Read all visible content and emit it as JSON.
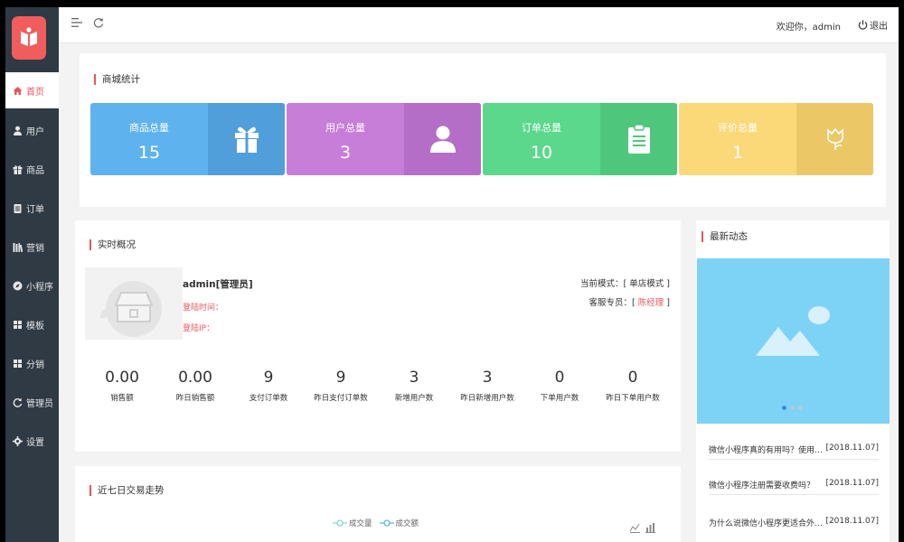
{
  "sidebar": {
    "items": [
      {
        "label": "首页",
        "icon": "home-icon",
        "active": true
      },
      {
        "label": "用户",
        "icon": "user-icon"
      },
      {
        "label": "商品",
        "icon": "gift-icon"
      },
      {
        "label": "订单",
        "icon": "clipboard-icon"
      },
      {
        "label": "营销",
        "icon": "books-icon"
      },
      {
        "label": "小程序",
        "icon": "compass-icon"
      },
      {
        "label": "模板",
        "icon": "grid-icon"
      },
      {
        "label": "分销",
        "icon": "grid-icon"
      },
      {
        "label": "管理员",
        "icon": "refresh-icon"
      },
      {
        "label": "设置",
        "icon": "gear-icon"
      }
    ]
  },
  "topbar": {
    "welcome": "欢迎你，admin",
    "logout": "退出"
  },
  "mall_stats": {
    "title": "商城统计",
    "cards": [
      {
        "label": "商品总量",
        "value": "15",
        "icon": "gift-icon",
        "color": "#5eb2ee",
        "color_dark": "#519fda"
      },
      {
        "label": "用户总量",
        "value": "3",
        "icon": "user-icon",
        "color": "#c67ed8",
        "color_dark": "#b56ec7"
      },
      {
        "label": "订单总量",
        "value": "10",
        "icon": "clipboard-icon",
        "color": "#5bd88b",
        "color_dark": "#4ec77d"
      },
      {
        "label": "评价总量",
        "value": "1",
        "icon": "tulip-icon",
        "color": "#fbd878",
        "color_dark": "#ecc766"
      }
    ]
  },
  "overview": {
    "title": "实时概况",
    "account": "admin[管理员]",
    "login_time_label": "登陆时间：",
    "login_ip_label": "登陆IP：",
    "mode": "当前模式：[ 单店模式 ]",
    "service_label": "客服专员：[ ",
    "service_name": "陈经理",
    "service_end": " ]",
    "metrics": [
      {
        "value": "0.00",
        "label": "销售额"
      },
      {
        "value": "0.00",
        "label": "昨日销售额"
      },
      {
        "value": "9",
        "label": "支付订单数"
      },
      {
        "value": "9",
        "label": "昨日支付订单数"
      },
      {
        "value": "3",
        "label": "新增用户数"
      },
      {
        "value": "3",
        "label": "昨日新增用户数"
      },
      {
        "value": "0",
        "label": "下单用户数"
      },
      {
        "value": "0",
        "label": "昨日下单用户数"
      }
    ]
  },
  "trend": {
    "title": "近七日交易走势",
    "legend": [
      "成交量",
      "成交额"
    ]
  },
  "news": {
    "title": "最新动态",
    "items": [
      {
        "title": "微信小程序真的有用吗？使用小程序的好处",
        "date": "[2018.11.07]"
      },
      {
        "title": "微信小程序注册需要收费吗？",
        "date": "[2018.11.07]"
      },
      {
        "title": "为什么说微信小程序更适合外卖行业",
        "date": "[2018.11.07]"
      }
    ]
  },
  "colors": {
    "accent": "#e9545d",
    "sidebar": "#2f3a45",
    "banner": "#7dd3f5"
  }
}
